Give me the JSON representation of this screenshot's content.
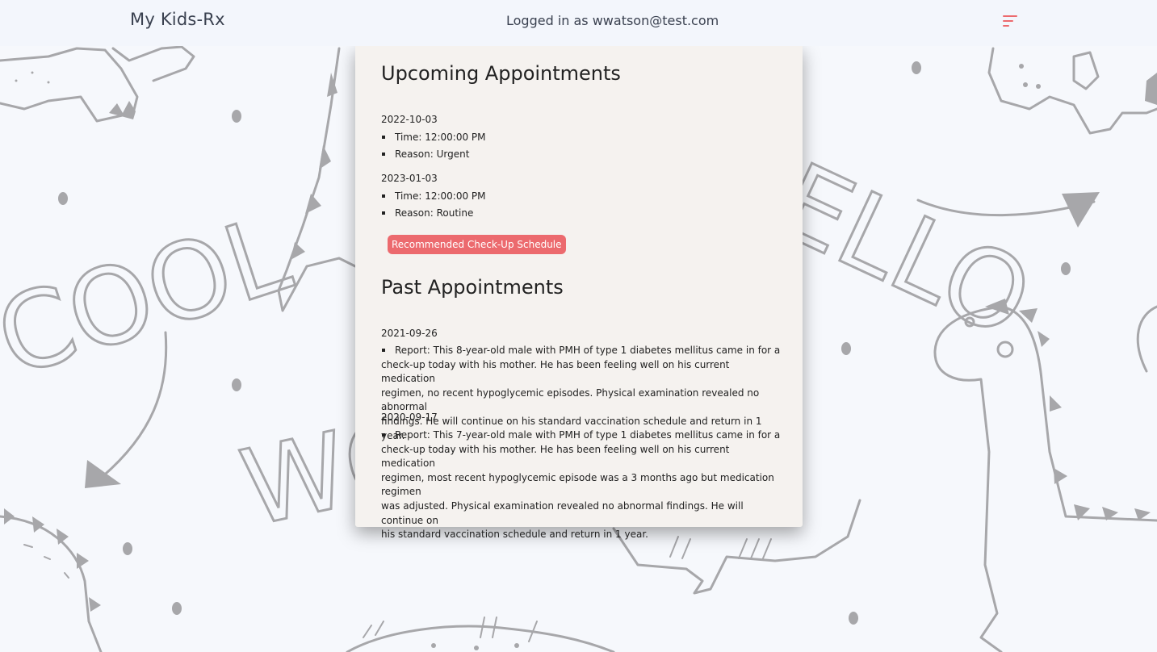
{
  "navbar": {
    "brand": "My Kids-Rx",
    "login_status": "Logged in as wwatson@test.com"
  },
  "background_text": [
    "COOL",
    "HELLO",
    "WO"
  ],
  "upcoming": {
    "title": "Upcoming Appointments",
    "appointments": [
      {
        "date": "2022-10-03",
        "time": "Time: 12:00:00 PM",
        "reason": "Reason: Urgent"
      },
      {
        "date": "2023-01-03",
        "time": "Time: 12:00:00 PM",
        "reason": "Reason: Routine"
      }
    ]
  },
  "checkup_button_label": "Recommended Check-Up Schedule",
  "past": {
    "title": "Past Appointments",
    "appointments": [
      {
        "date": "2021-09-26",
        "report_line1": "Report: This 8-year-old male with PMH of type 1 diabetes mellitus came in for a",
        "report_line2": "check-up today with his mother. He has been feeling well on his current medication",
        "report_line3": "regimen, no recent hypoglycemic episodes. Physical examination revealed no abnormal",
        "report_line4": "findings. He will continue on his standard vaccination schedule and return in 1 year."
      },
      {
        "date": "2020-09-17",
        "report_line1": "Report: This 7-year-old male with PMH of type 1 diabetes mellitus came in for a",
        "report_line2": "check-up today with his mother. He has been feeling well on his current medication",
        "report_line3": "regimen, most recent hypoglycemic episode was a 3 months ago but medication regimen",
        "report_line4": "was adjusted. Physical examination revealed no abnormal findings. He will continue on",
        "report_line5": "his standard vaccination schedule and return in 1 year."
      }
    ]
  },
  "colors": {
    "accent": "#ec6a6e",
    "card_bg": "#f5f2ef",
    "page_bg": "#f6f8fc",
    "doodle": "#a7a7aa"
  },
  "icons": {
    "menu": "menu-icon"
  }
}
